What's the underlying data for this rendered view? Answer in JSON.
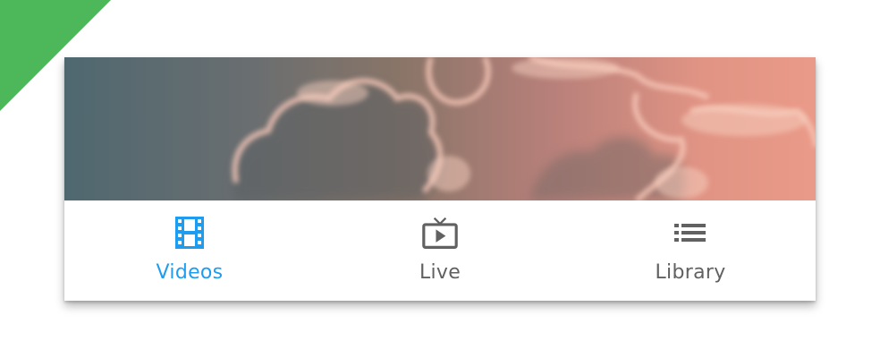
{
  "colors": {
    "accent": "#1e9df0",
    "inactive": "#616161",
    "corner_badge": "#4cb85a"
  },
  "hero": {
    "image": "pink-clouds-sunset-banner"
  },
  "bottom_nav": {
    "selected": "Videos",
    "items": [
      {
        "label": "Videos",
        "icon": "film-icon",
        "active": true
      },
      {
        "label": "Live",
        "icon": "live-tv-icon",
        "active": false
      },
      {
        "label": "Library",
        "icon": "list-icon",
        "active": false
      }
    ]
  }
}
